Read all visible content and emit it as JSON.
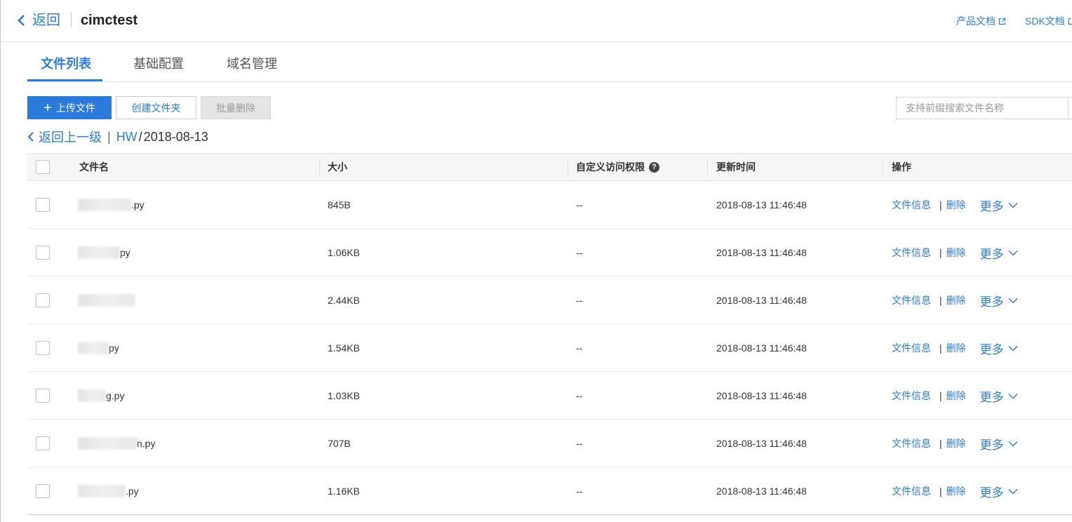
{
  "header": {
    "back_label": "返回",
    "title": "cimctest",
    "product_docs": "产品文档",
    "sdk_docs": "SDK文档"
  },
  "tabs": [
    {
      "label": "文件列表",
      "active": true
    },
    {
      "label": "基础配置",
      "active": false
    },
    {
      "label": "域名管理",
      "active": false
    }
  ],
  "toolbar": {
    "upload_label": "上传文件",
    "create_folder_label": "创建文件夹",
    "batch_delete_label": "批量删除",
    "search_placeholder": "支持前缀搜索文件名称"
  },
  "breadcrumb": {
    "back_label": "返回上一级",
    "separator": "|",
    "folder": "HW",
    "slash": "/",
    "current": "2018-08-13"
  },
  "table": {
    "columns": {
      "name": "文件名",
      "size": "大小",
      "permission": "自定义访问权限",
      "updated": "更新时间",
      "actions": "操作"
    },
    "help_glyph": "?",
    "rows": [
      {
        "name_suffix": ".py",
        "size": "845B",
        "permission": "--",
        "updated": "2018-08-13 11:46:48"
      },
      {
        "name_suffix": "py",
        "size": "1.06KB",
        "permission": "--",
        "updated": "2018-08-13 11:46:48"
      },
      {
        "name_suffix": "",
        "size": "2.44KB",
        "permission": "--",
        "updated": "2018-08-13 11:46:48"
      },
      {
        "name_suffix": "py",
        "size": "1.54KB",
        "permission": "--",
        "updated": "2018-08-13 11:46:48"
      },
      {
        "name_suffix": "g.py",
        "size": "1.03KB",
        "permission": "--",
        "updated": "2018-08-13 11:46:48"
      },
      {
        "name_suffix": "n.py",
        "size": "707B",
        "permission": "--",
        "updated": "2018-08-13 11:46:48"
      },
      {
        "name_suffix": ".py",
        "size": "1.16KB",
        "permission": "--",
        "updated": "2018-08-13 11:46:48"
      }
    ],
    "row_actions": {
      "info": "文件信息",
      "separator": "|",
      "delete": "删除",
      "more": "更多"
    }
  },
  "colors": {
    "accent": "#2b7bdc",
    "header_bg": "#f5f6f7",
    "disabled_bg": "#e6e6e6"
  }
}
